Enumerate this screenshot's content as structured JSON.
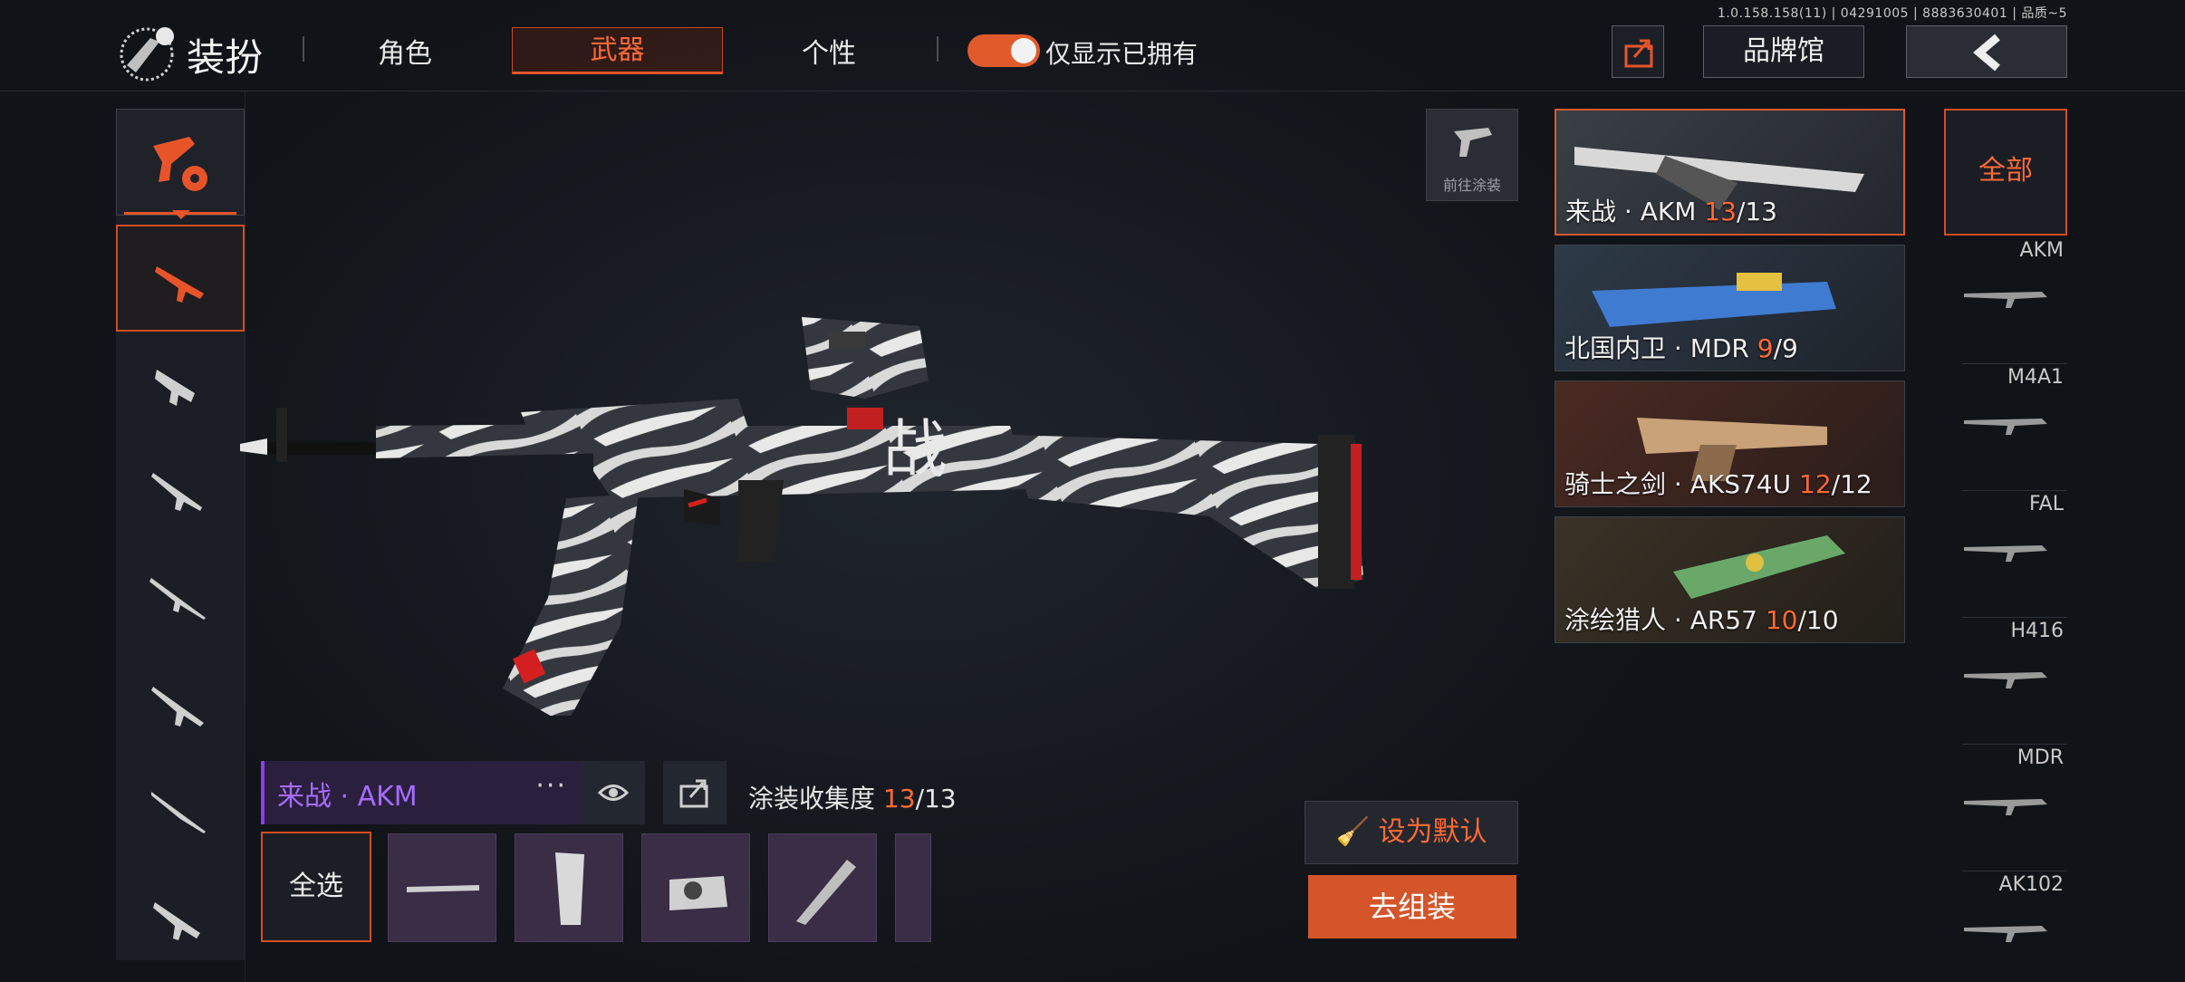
{
  "version": "1.0.158.158(11) | 04291005 | 8883630401 | 品质~5",
  "header": {
    "title": "装扮",
    "tabs": [
      {
        "label": "角色",
        "active": false
      },
      {
        "label": "武器",
        "active": true
      },
      {
        "label": "个性",
        "active": false
      }
    ],
    "toggle_label": "仅显示已拥有",
    "toggle_on": true,
    "brand_label": "品牌馆"
  },
  "goto_paint_label": "前往涂装",
  "current_skin": {
    "name": "来战 · AKM",
    "collection_label": "涂装收集度",
    "collected": "13",
    "total": "/13"
  },
  "actions": {
    "select_all": "全选",
    "set_default": "设为默认",
    "assemble": "去组装"
  },
  "skin_cards": [
    {
      "name": "来战 · AKM",
      "count": "13",
      "total": "/13",
      "selected": true
    },
    {
      "name": "北国内卫 · MDR",
      "count": "9",
      "total": "/9",
      "selected": false
    },
    {
      "name": "骑士之剑 · AKS74U",
      "count": "12",
      "total": "/12",
      "selected": false
    },
    {
      "name": "涂绘猎人 · AR57",
      "count": "10",
      "total": "/10",
      "selected": false
    }
  ],
  "filter": {
    "all_label": "全部",
    "items": [
      "AKM",
      "M4A1",
      "FAL",
      "H416",
      "MDR",
      "AK102"
    ]
  },
  "colors": {
    "accent": "#e8542a",
    "purple": "#a66cff",
    "bg": "#14181d"
  }
}
